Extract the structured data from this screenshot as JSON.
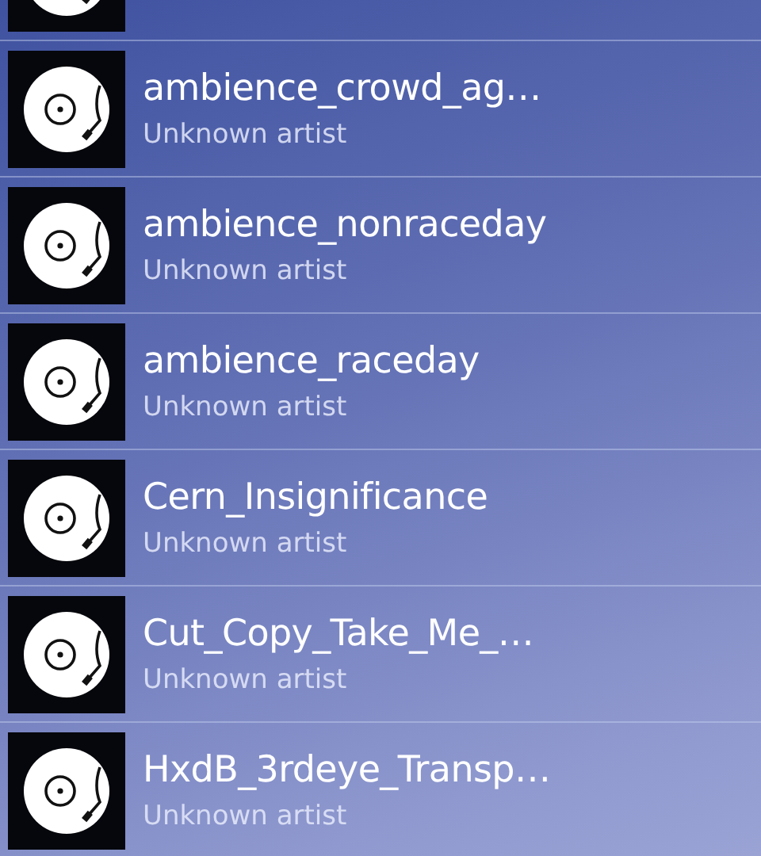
{
  "tracks": [
    {
      "kind": "partial"
    },
    {
      "kind": "track",
      "title": "ambience_crowd_ag…",
      "artist": "Unknown artist"
    },
    {
      "kind": "track",
      "title": "ambience_nonraceday",
      "artist": "Unknown artist"
    },
    {
      "kind": "track",
      "title": "ambience_raceday",
      "artist": "Unknown artist"
    },
    {
      "kind": "track",
      "title": "Cern_Insignificance",
      "artist": "Unknown artist"
    },
    {
      "kind": "track",
      "title": "Cut_Copy_Take_Me_…",
      "artist": "Unknown artist"
    },
    {
      "kind": "track",
      "title": "HxdB_3rdeye_Transp…",
      "artist": "Unknown artist"
    }
  ]
}
